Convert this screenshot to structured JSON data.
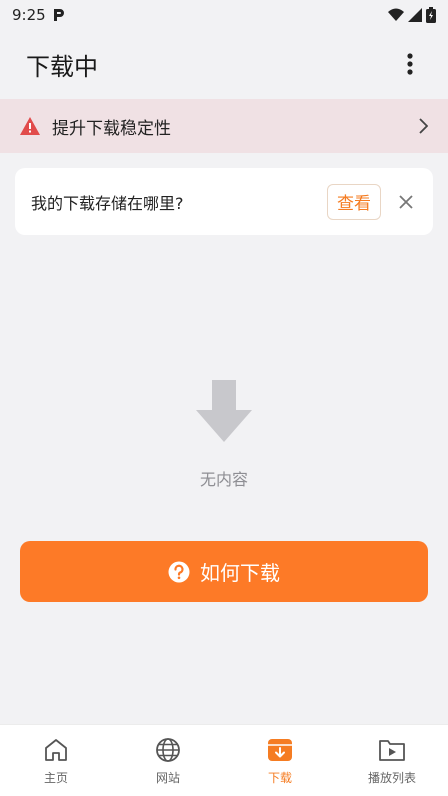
{
  "status_bar": {
    "time": "9:25"
  },
  "app_bar": {
    "title": "下载中"
  },
  "banner": {
    "label": "提升下载稳定性"
  },
  "info_card": {
    "question": "我的下载存储在哪里?",
    "view_label": "查看"
  },
  "empty_state": {
    "label": "无内容"
  },
  "how_button": {
    "label": "如何下载"
  },
  "nav": {
    "items": [
      {
        "label": "主页",
        "icon": "home-icon",
        "active": false
      },
      {
        "label": "网站",
        "icon": "globe-icon",
        "active": false
      },
      {
        "label": "下载",
        "icon": "download-icon",
        "active": true
      },
      {
        "label": "播放列表",
        "icon": "playlist-icon",
        "active": false
      }
    ]
  },
  "colors": {
    "accent": "#f57c22",
    "button": "#fd7a27",
    "banner_bg": "#f0e1e4",
    "warning": "#e14b4b"
  }
}
